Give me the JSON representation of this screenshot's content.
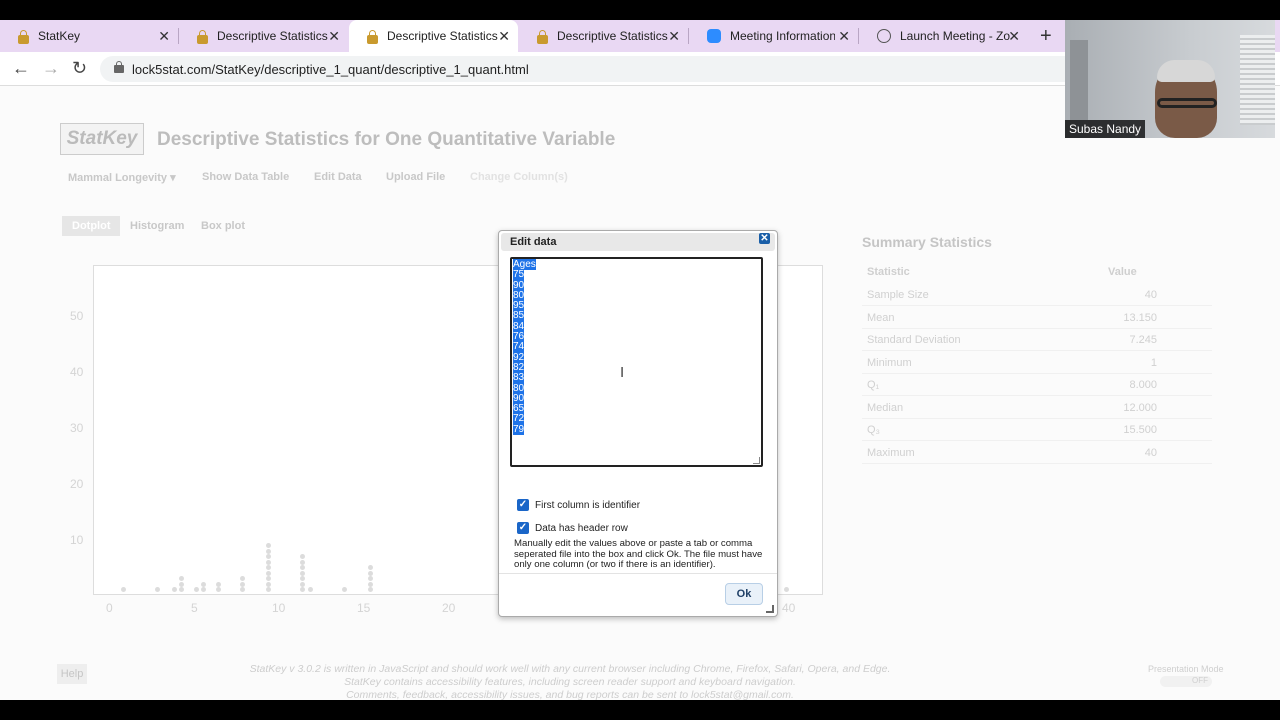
{
  "browser": {
    "tabs": [
      {
        "label": "StatKey",
        "icon": "lock-icon",
        "active": false
      },
      {
        "label": "Descriptive Statistics",
        "icon": "lock-icon",
        "active": false
      },
      {
        "label": "Descriptive Statistics",
        "icon": "lock-icon",
        "active": true
      },
      {
        "label": "Descriptive Statistics",
        "icon": "lock-icon",
        "active": false
      },
      {
        "label": "Meeting Information -",
        "icon": "zoom-icon",
        "active": false
      },
      {
        "label": "Launch Meeting - Zoo",
        "icon": "globe-icon",
        "active": false
      }
    ],
    "url": "lock5stat.com/StatKey/descriptive_1_quant/descriptive_1_quant.html"
  },
  "page": {
    "logo": "StatKey",
    "title": "Descriptive Statistics for One Quantitative Variable",
    "menu": [
      "Mammal Longevity",
      "Show Data Table",
      "Edit Data",
      "Upload File",
      "Change Column(s)"
    ],
    "plot_tabs": [
      "Dotplot",
      "Histogram",
      "Box plot"
    ],
    "yticks": [
      "50",
      "40",
      "30",
      "20",
      "10"
    ],
    "xticks": [
      "0",
      "5",
      "10",
      "15",
      "20",
      "40"
    ],
    "summary": {
      "title": "Summary Statistics",
      "col_stat": "Statistic",
      "col_value": "Value",
      "rows": [
        {
          "k": "Sample Size",
          "v": "40"
        },
        {
          "k": "Mean",
          "v": "13.150"
        },
        {
          "k": "Standard Deviation",
          "v": "7.245"
        },
        {
          "k": "Minimum",
          "v": "1"
        },
        {
          "k": "Q₁",
          "v": "8.000"
        },
        {
          "k": "Median",
          "v": "12.000"
        },
        {
          "k": "Q₃",
          "v": "15.500"
        },
        {
          "k": "Maximum",
          "v": "40"
        }
      ]
    },
    "help": "Help",
    "footer": [
      "StatKey v 3.0.2 is written in JavaScript and should work well with any current browser including Chrome, Firefox, Safari, Opera, and Edge.",
      "StatKey contains accessibility features, including screen reader support and keyboard navigation.",
      "Comments, feedback, accessibility issues, and bug reports can be sent to lock5stat@gmail.com."
    ],
    "presentation_mode": "Presentation Mode",
    "presentation_toggle": "OFF"
  },
  "dialog": {
    "title": "Edit data",
    "data_lines": [
      "Ages",
      "75",
      "90",
      "80",
      "95",
      "85",
      "84",
      "76",
      "74",
      "92",
      "82",
      "83",
      "80",
      "90",
      "65",
      "72",
      "79"
    ],
    "checkbox_identifier": "First column is identifier",
    "checkbox_header": "Data has header row",
    "help_text": "Manually edit the values above or paste a tab or comma seperated file into the box and click Ok. The file must have only one column (or two if there is an identifier).",
    "ok": "Ok"
  },
  "webcam": {
    "name": "Subas Nandy"
  }
}
